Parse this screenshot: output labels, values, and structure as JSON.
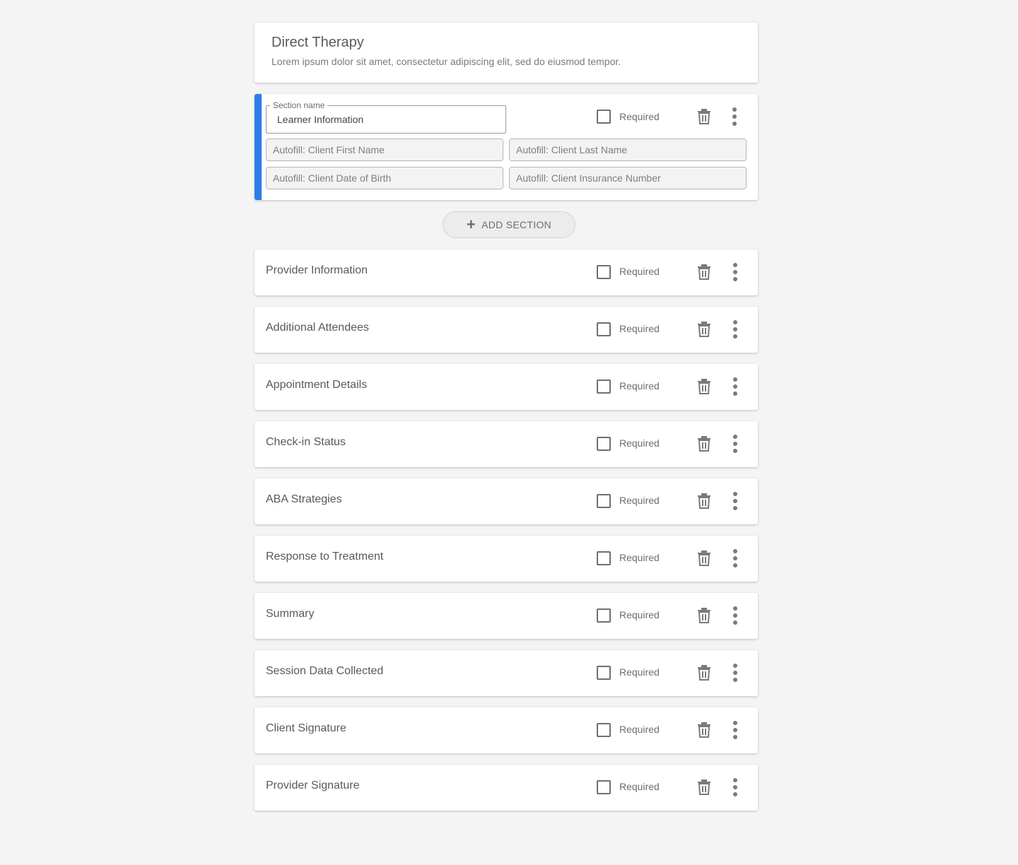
{
  "form": {
    "title": "Direct Therapy",
    "description": "Lorem ipsum dolor sit amet, consectetur adipiscing elit, sed do eiusmod tempor."
  },
  "active_section": {
    "legend": "Section name",
    "name": "Learner Information",
    "required_label": "Required",
    "autofill_fields": [
      "Autofill: Client First Name",
      "Autofill: Client Last Name",
      "Autofill: Client Date of Birth",
      "Autofill: Client Insurance Number"
    ]
  },
  "add_section_label": "ADD SECTION",
  "sections": [
    {
      "name": "Provider Information",
      "required_label": "Required"
    },
    {
      "name": "Additional Attendees",
      "required_label": "Required"
    },
    {
      "name": "Appointment Details",
      "required_label": "Required"
    },
    {
      "name": "Check-in Status",
      "required_label": "Required"
    },
    {
      "name": "ABA Strategies",
      "required_label": "Required"
    },
    {
      "name": "Response to Treatment",
      "required_label": "Required"
    },
    {
      "name": "Summary",
      "required_label": "Required"
    },
    {
      "name": "Session Data Collected",
      "required_label": "Required"
    },
    {
      "name": "Client Signature",
      "required_label": "Required"
    },
    {
      "name": "Provider Signature",
      "required_label": "Required"
    }
  ],
  "colors": {
    "accent": "#2b7de9",
    "background": "#f4f4f4",
    "icon": "#7a7a7a"
  },
  "icons": {
    "delete": "trash-icon",
    "more": "more-vert-icon",
    "add": "plus-icon"
  }
}
